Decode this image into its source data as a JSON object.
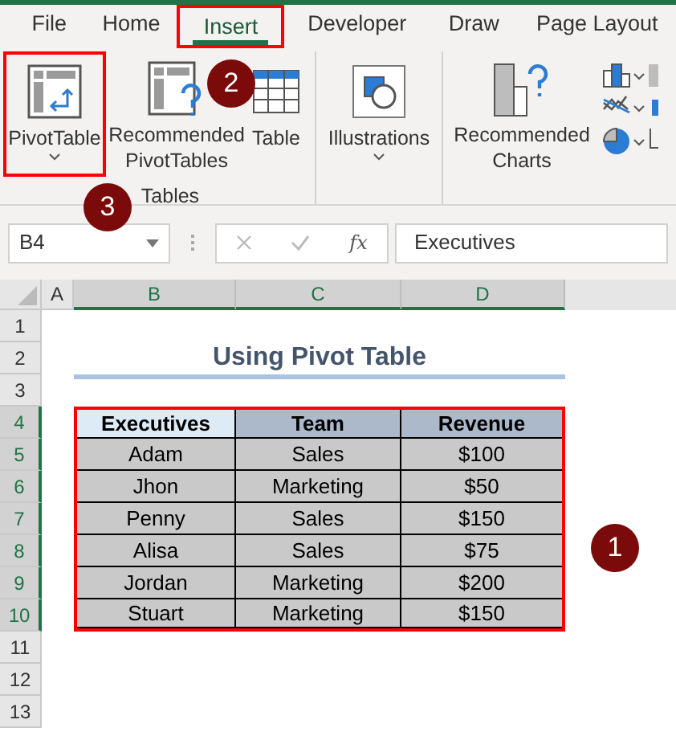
{
  "ribbon_tabs": [
    {
      "label": "File",
      "selected": false,
      "outlined": false
    },
    {
      "label": "Home",
      "selected": false,
      "outlined": false
    },
    {
      "label": "Insert",
      "selected": true,
      "outlined": true
    },
    {
      "label": "Developer",
      "selected": false,
      "outlined": false
    },
    {
      "label": "Draw",
      "selected": false,
      "outlined": false
    },
    {
      "label": "Page Layout",
      "selected": false,
      "outlined": false
    }
  ],
  "ribbon_groups": [
    {
      "label": "Tables",
      "buttons": [
        {
          "kind": "pivot",
          "label": "PivotTable",
          "dropdown": true,
          "outlined": true
        },
        {
          "kind": "recommended_pivot",
          "label": "Recommended PivotTables",
          "dropdown": false,
          "outlined": false
        },
        {
          "kind": "table",
          "label": "Table",
          "dropdown": false,
          "outlined": false
        }
      ]
    },
    {
      "buttons": [
        {
          "kind": "illustrations",
          "label": "Illustrations",
          "dropdown": true,
          "outlined": false
        }
      ]
    },
    {
      "buttons": [
        {
          "kind": "recommended_charts",
          "label": "Recommended Charts",
          "dropdown": false,
          "outlined": false
        },
        {
          "kind": "chart_gallery",
          "outlined": false
        }
      ]
    }
  ],
  "formula_bar": {
    "name_box": "B4",
    "fx": "fx",
    "value": "Executives"
  },
  "sheet": {
    "columns": [
      {
        "label": "A",
        "selected": false
      },
      {
        "label": "B",
        "selected": true
      },
      {
        "label": "C",
        "selected": true
      },
      {
        "label": "D",
        "selected": true
      }
    ],
    "rows": [
      {
        "label": "1",
        "selected": false
      },
      {
        "label": "2",
        "selected": false
      },
      {
        "label": "3",
        "selected": false
      },
      {
        "label": "4",
        "selected": true
      },
      {
        "label": "5",
        "selected": true
      },
      {
        "label": "6",
        "selected": true
      },
      {
        "label": "7",
        "selected": true
      },
      {
        "label": "8",
        "selected": true
      },
      {
        "label": "9",
        "selected": true
      },
      {
        "label": "10",
        "selected": true
      },
      {
        "label": "11",
        "selected": false
      },
      {
        "label": "12",
        "selected": false
      },
      {
        "label": "13",
        "selected": false
      }
    ],
    "title": "Using Pivot Table",
    "table": {
      "columns": [
        "Executives",
        "Team",
        "Revenue"
      ],
      "rows": [
        [
          "Adam",
          "Sales",
          "$100"
        ],
        [
          "Jhon",
          "Marketing",
          "$50"
        ],
        [
          "Penny",
          "Sales",
          "$150"
        ],
        [
          "Alisa",
          "Sales",
          "$75"
        ],
        [
          "Jordan",
          "Marketing",
          "$200"
        ],
        [
          "Stuart",
          "Marketing",
          "$150"
        ]
      ]
    }
  },
  "callouts": [
    {
      "text": "2"
    },
    {
      "text": "3"
    },
    {
      "text": "1"
    }
  ]
}
